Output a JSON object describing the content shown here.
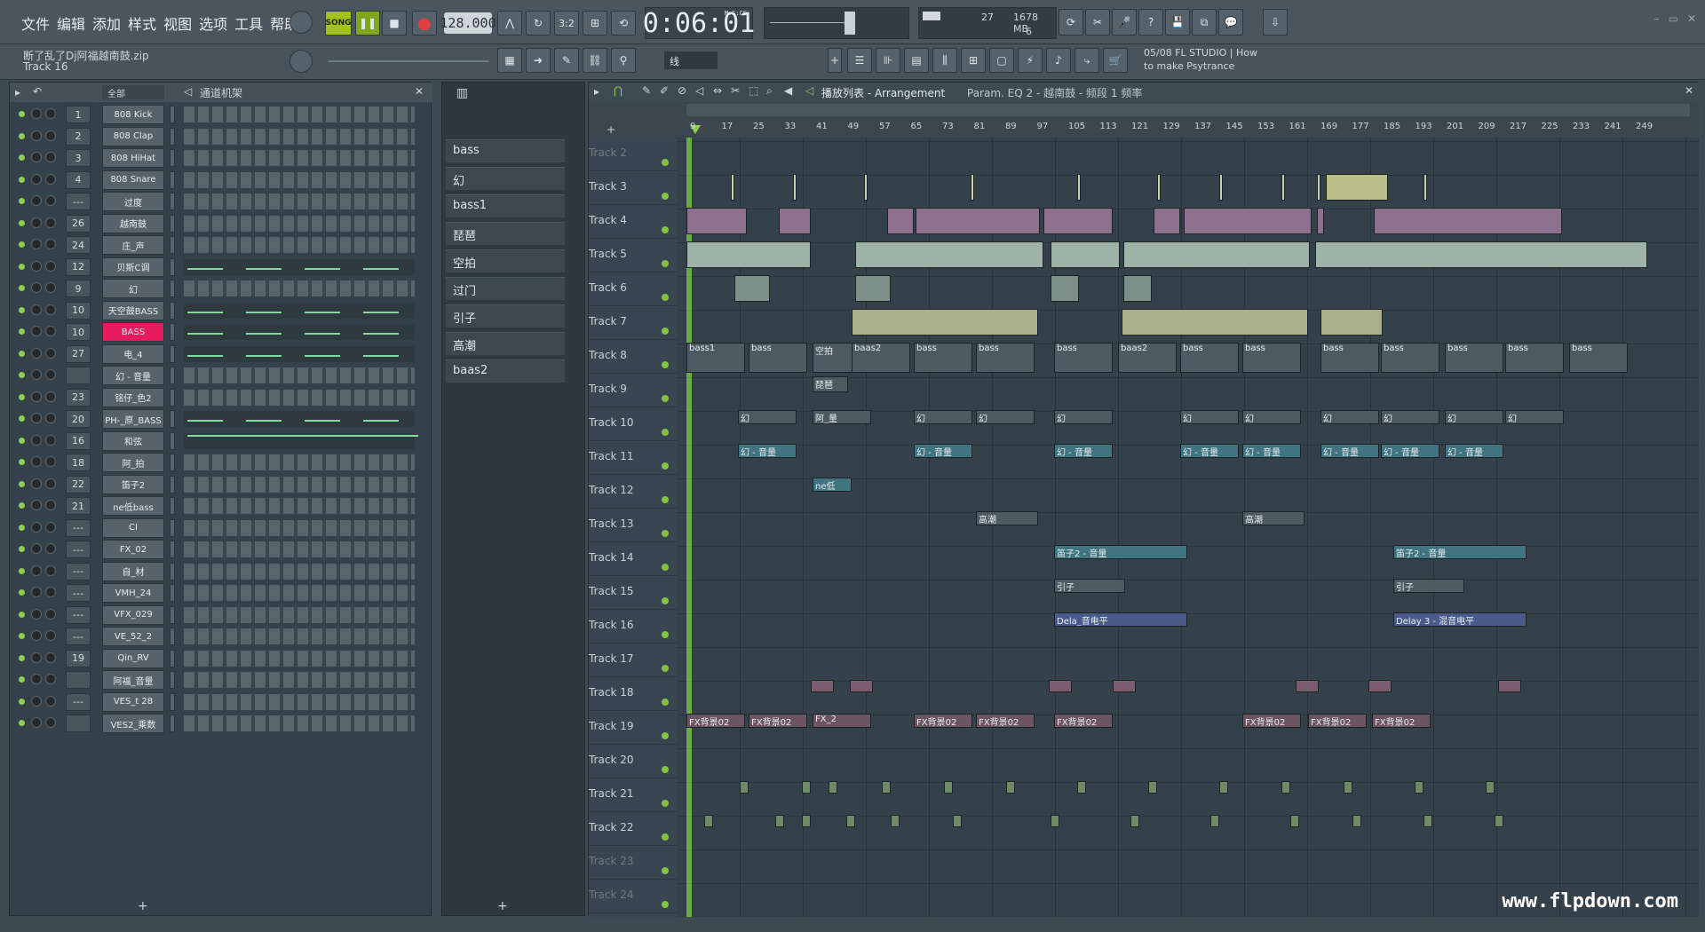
{
  "menu": [
    "文件",
    "编辑",
    "添加",
    "样式",
    "视图",
    "选项",
    "工具",
    "帮助"
  ],
  "transport": {
    "mode": "SONG",
    "tempo": "128.000",
    "time": "0:06:01",
    "time_unit": "M:S:CS",
    "ram": "1678 MB",
    "voices": "27",
    "cpu": "6"
  },
  "hint": {
    "file": "断了乱了Dj阿福越南鼓.zip",
    "track": "Track 16"
  },
  "snap": "线",
  "pattern": "bass",
  "news": {
    "date": "05/08",
    "line1": "FL STUDIO | How",
    "line2": "to make Psytrance"
  },
  "rack": {
    "filter": "全部",
    "title": "通道机架"
  },
  "channels": [
    {
      "num": "1",
      "name": "808 Kick"
    },
    {
      "num": "2",
      "name": "808 Clap"
    },
    {
      "num": "3",
      "name": "808 HiHat"
    },
    {
      "num": "4",
      "name": "808 Snare"
    },
    {
      "num": "---",
      "name": "过度"
    },
    {
      "num": "26",
      "name": "越南鼓"
    },
    {
      "num": "24",
      "name": "庄_声"
    },
    {
      "num": "12",
      "name": "贝斯C调"
    },
    {
      "num": "9",
      "name": "幻"
    },
    {
      "num": "10",
      "name": "天空鼓BASS"
    },
    {
      "num": "10",
      "name": "BASS"
    },
    {
      "num": "27",
      "name": "电_4"
    },
    {
      "num": "",
      "name": "幻 - 音量"
    },
    {
      "num": "23",
      "name": "铭仔_色2"
    },
    {
      "num": "20",
      "name": "PH-_原_BASS"
    },
    {
      "num": "16",
      "name": "和弦"
    },
    {
      "num": "18",
      "name": "阿_拍"
    },
    {
      "num": "22",
      "name": "笛子2"
    },
    {
      "num": "21",
      "name": "ne低bass"
    },
    {
      "num": "---",
      "name": "CI"
    },
    {
      "num": "---",
      "name": "FX_02"
    },
    {
      "num": "---",
      "name": "自_材"
    },
    {
      "num": "---",
      "name": "VMH_24"
    },
    {
      "num": "---",
      "name": "VFX_029"
    },
    {
      "num": "---",
      "name": "VE_52_2"
    },
    {
      "num": "19",
      "name": "Qin_RV"
    },
    {
      "num": "",
      "name": "阿福_音量"
    },
    {
      "num": "---",
      "name": "VES_t 28"
    },
    {
      "num": "",
      "name": "VES2_乘数"
    }
  ],
  "patterns": [
    "bass",
    "幻",
    "bass1",
    "琵琶",
    "空拍",
    "过门",
    "引子",
    "高潮",
    "baas2"
  ],
  "playlist": {
    "title": "播放列表 - Arrangement",
    "breadcrumb": "Param. EQ 2 - 越南鼓 - 频段 1 频率"
  },
  "ruler": [
    "9",
    "17",
    "25",
    "33",
    "41",
    "49",
    "57",
    "65",
    "73",
    "81",
    "89",
    "97",
    "105",
    "113",
    "121",
    "129",
    "137",
    "145",
    "153",
    "161",
    "169",
    "177",
    "185",
    "193",
    "201",
    "209",
    "217",
    "225",
    "233",
    "241",
    "249"
  ],
  "tracks": [
    "Track 2",
    "Track 3",
    "Track 4",
    "Track 5",
    "Track 6",
    "Track 7",
    "Track 8",
    "Track 9",
    "Track 10",
    "Track 11",
    "Track 12",
    "Track 13",
    "Track 14",
    "Track 15",
    "Track 16",
    "Track 17",
    "Track 18",
    "Track 19",
    "Track 20",
    "Track 21",
    "Track 22",
    "Track 23",
    "Track 24"
  ],
  "clips": {
    "t8": [
      "bass1",
      "bass",
      "空拍",
      "baas2",
      "bass",
      "bass",
      "bass",
      "baas2",
      "bass",
      "bass",
      "bass",
      "bass",
      "bass",
      "bass",
      "bass"
    ],
    "t9": "琵琶",
    "t10": [
      "幻",
      "阿_量",
      "幻",
      "幻",
      "幻",
      "幻",
      "幻",
      "幻",
      "幻",
      "幻",
      "幻"
    ],
    "t11": [
      "幻 - 音量",
      "幻 - 音量",
      "幻 - 音量",
      "幻 - 音量",
      "幻 - 音量",
      "幻 - 音量",
      "幻 - 音量",
      "幻 - 音量"
    ],
    "t12": "ne低",
    "t13": [
      "高潮",
      "高潮"
    ],
    "t14": [
      "笛子2 - 音量",
      "笛子2 - 音量"
    ],
    "t15": [
      "引子",
      "引子"
    ],
    "t16": [
      "Dela_音电平",
      "Delay 3 - 混音电平"
    ],
    "t19": [
      "FX背景02",
      "FX背景02",
      "FX_2",
      "FX背景02",
      "FX背景02",
      "FX背景02",
      "FX背景02",
      "FX背景02",
      "FX背景02"
    ]
  },
  "watermark": "www.flpdown.com"
}
